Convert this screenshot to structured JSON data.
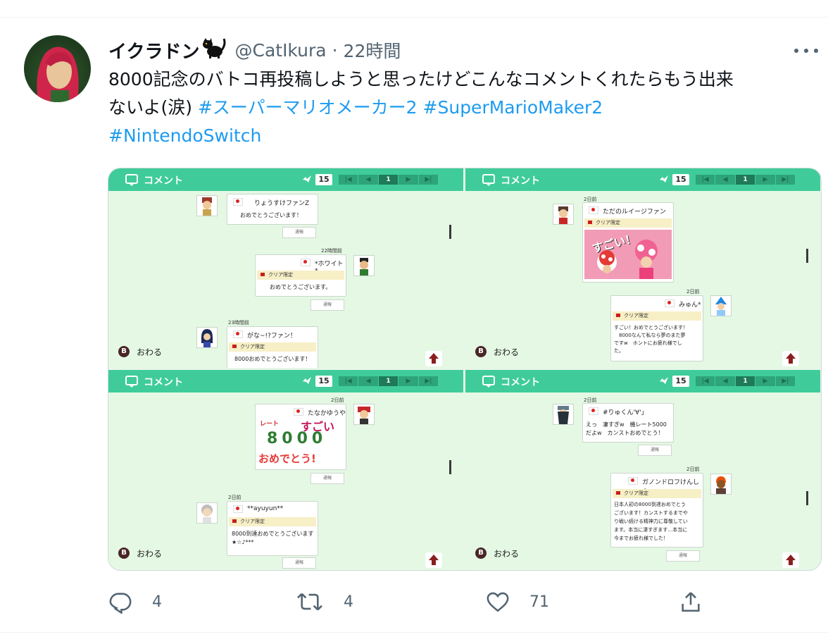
{
  "tweet": {
    "display_name": "イクラドン",
    "handle": "@CatIkura",
    "separator": "·",
    "time": "22時間",
    "text_lines": [
      {
        "plain": "8000記念のバトコ再投稿しようと思ったけどこんなコメントくれたらもう出来"
      },
      {
        "plain": "ないよ(涙) ",
        "tags": [
          "#スーパーマリオメーカー2",
          "#SuperMarioMaker2"
        ]
      },
      {
        "tags": [
          "#NintendoSwitch"
        ]
      }
    ]
  },
  "icons": {
    "name_badge": "black-cat-icon",
    "more": "more-options-icon",
    "reply": "reply-icon",
    "retweet": "retweet-icon",
    "like": "like-icon",
    "share": "share-icon"
  },
  "colors": {
    "link": "#1d9bf0",
    "secondary": "#536471",
    "game_header": "#3fcc9a"
  },
  "media": {
    "panels": [
      {
        "header_title": "コメント",
        "count": "15",
        "page": "1",
        "close_label": "おわる",
        "close_key": "B",
        "comments": [
          {
            "time": "",
            "name": "りょうすけファンZ",
            "clear_tag": "",
            "body": "おめでとうございます！",
            "report": "通報"
          },
          {
            "time": "22時間前",
            "name": "*ホワイト*",
            "clear_tag": "クリア限定",
            "body": "おめでとうございます。",
            "report": "通報"
          },
          {
            "time": "23時間前",
            "name": "がな~!?ファン！",
            "clear_tag": "クリア限定",
            "body": "8000おめでとうございます！",
            "report": ""
          }
        ]
      },
      {
        "header_title": "コメント",
        "count": "15",
        "page": "1",
        "close_label": "おわる",
        "close_key": "B",
        "comments": [
          {
            "time": "2日前",
            "name": "ただのルイージファン",
            "clear_tag": "クリア限定",
            "body": "",
            "drawing_text": "すごい！",
            "report": ""
          },
          {
            "time": "2日前",
            "name": "みゅん*",
            "clear_tag": "クリア限定",
            "body": "すごい！おめでとうございます！\n　8000なんて私なら夢のまた夢\nですw　ホントにお疲れ様でし\nた。",
            "report": ""
          }
        ]
      },
      {
        "header_title": "コメント",
        "count": "15",
        "page": "1",
        "close_label": "おわる",
        "close_key": "B",
        "comments": [
          {
            "time": "2日前",
            "name": "たなかゆうや",
            "clear_tag": "",
            "body": "",
            "drawing_lines": [
              "レート",
              "すごい",
              "8000",
              "おめでとう!"
            ],
            "report": "通報"
          },
          {
            "time": "2日前",
            "name": "**ayuyun**",
            "clear_tag": "クリア限定",
            "body": "8000到達おめでとうございます\n★☆♪***",
            "report": "通報"
          }
        ]
      },
      {
        "header_title": "コメント",
        "count": "15",
        "page": "1",
        "close_label": "おわる",
        "close_key": "B",
        "comments": [
          {
            "time": "2日前",
            "name": "#りゅくん'∀'」",
            "clear_tag": "",
            "body": "えっ　凄すぎw　機レート5000\nだよw　カンストおめでとう！",
            "report": "通報"
          },
          {
            "time": "2日前",
            "name": "ガノンドロフけんしん",
            "clear_tag": "クリア限定",
            "body": "日本人初の8000到達おめでとう\nございます！カンストするまでや\nり戦い続ける精神力に尊敬してい\nます。本当に凄すぎます…本当に\n今までお疲れ様でした！",
            "report": "通報"
          }
        ]
      }
    ]
  },
  "actions": {
    "replies": "4",
    "retweets": "4",
    "likes": "71"
  }
}
